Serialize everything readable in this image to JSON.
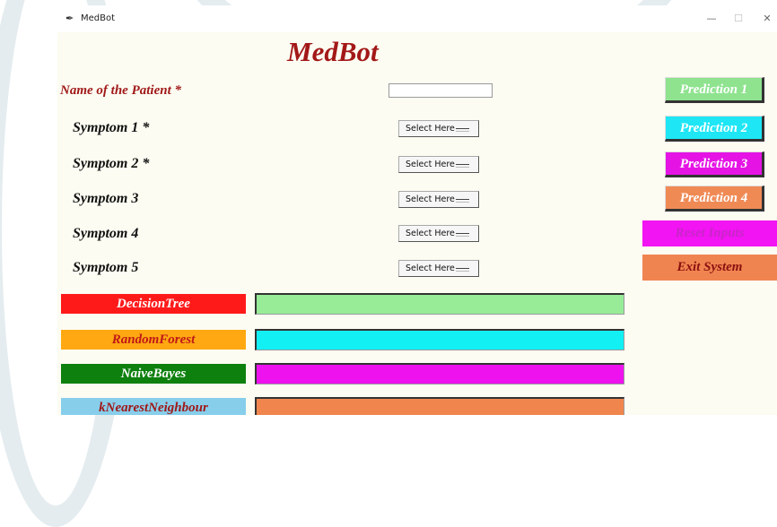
{
  "window": {
    "title": "MedBot",
    "icon": "feather-icon",
    "controls": [
      "—",
      "☐",
      "✕"
    ]
  },
  "app": {
    "heading": "MedBot"
  },
  "patient": {
    "label": "Name of the Patient *",
    "value": "",
    "placeholder": ""
  },
  "symptoms": [
    {
      "label": "Symptom 1 *",
      "selected": "Select Here"
    },
    {
      "label": "Symptom 2 *",
      "selected": "Select Here"
    },
    {
      "label": "Symptom 3",
      "selected": "Select Here"
    },
    {
      "label": "Symptom 4",
      "selected": "Select Here"
    },
    {
      "label": "Symptom 5",
      "selected": "Select Here"
    }
  ],
  "prediction_buttons": [
    {
      "label": "Prediction 1",
      "color": "#8fe38f"
    },
    {
      "label": "Prediction 2",
      "color": "#1ee6f5"
    },
    {
      "label": "Prediction 3",
      "color": "#e514e5"
    },
    {
      "label": "Prediction 4",
      "color": "#f08a55"
    }
  ],
  "actions": {
    "reset": {
      "label": "Reset Inputs",
      "color": "#f214f2",
      "text_color": "#c826c8"
    },
    "exit": {
      "label": "Exit System",
      "color": "#f08450",
      "text_color": "#8a1010"
    }
  },
  "algorithms": [
    {
      "name": "DecisionTree",
      "label_bg": "#ff1a1a",
      "label_color": "#ffffff",
      "output_color": "#98ec98",
      "output_value": ""
    },
    {
      "name": "RandomForest",
      "label_bg": "#ffa812",
      "label_color": "#c01818",
      "output_color": "#12f0f4",
      "output_value": ""
    },
    {
      "name": "NaiveBayes",
      "label_bg": "#0e800e",
      "label_color": "#ffffff",
      "output_color": "#ee12ee",
      "output_value": ""
    },
    {
      "name": "kNearestNeighbour",
      "label_bg": "#87ceeb",
      "label_color": "#a01818",
      "output_color": "#f0864e",
      "output_value": ""
    }
  ]
}
